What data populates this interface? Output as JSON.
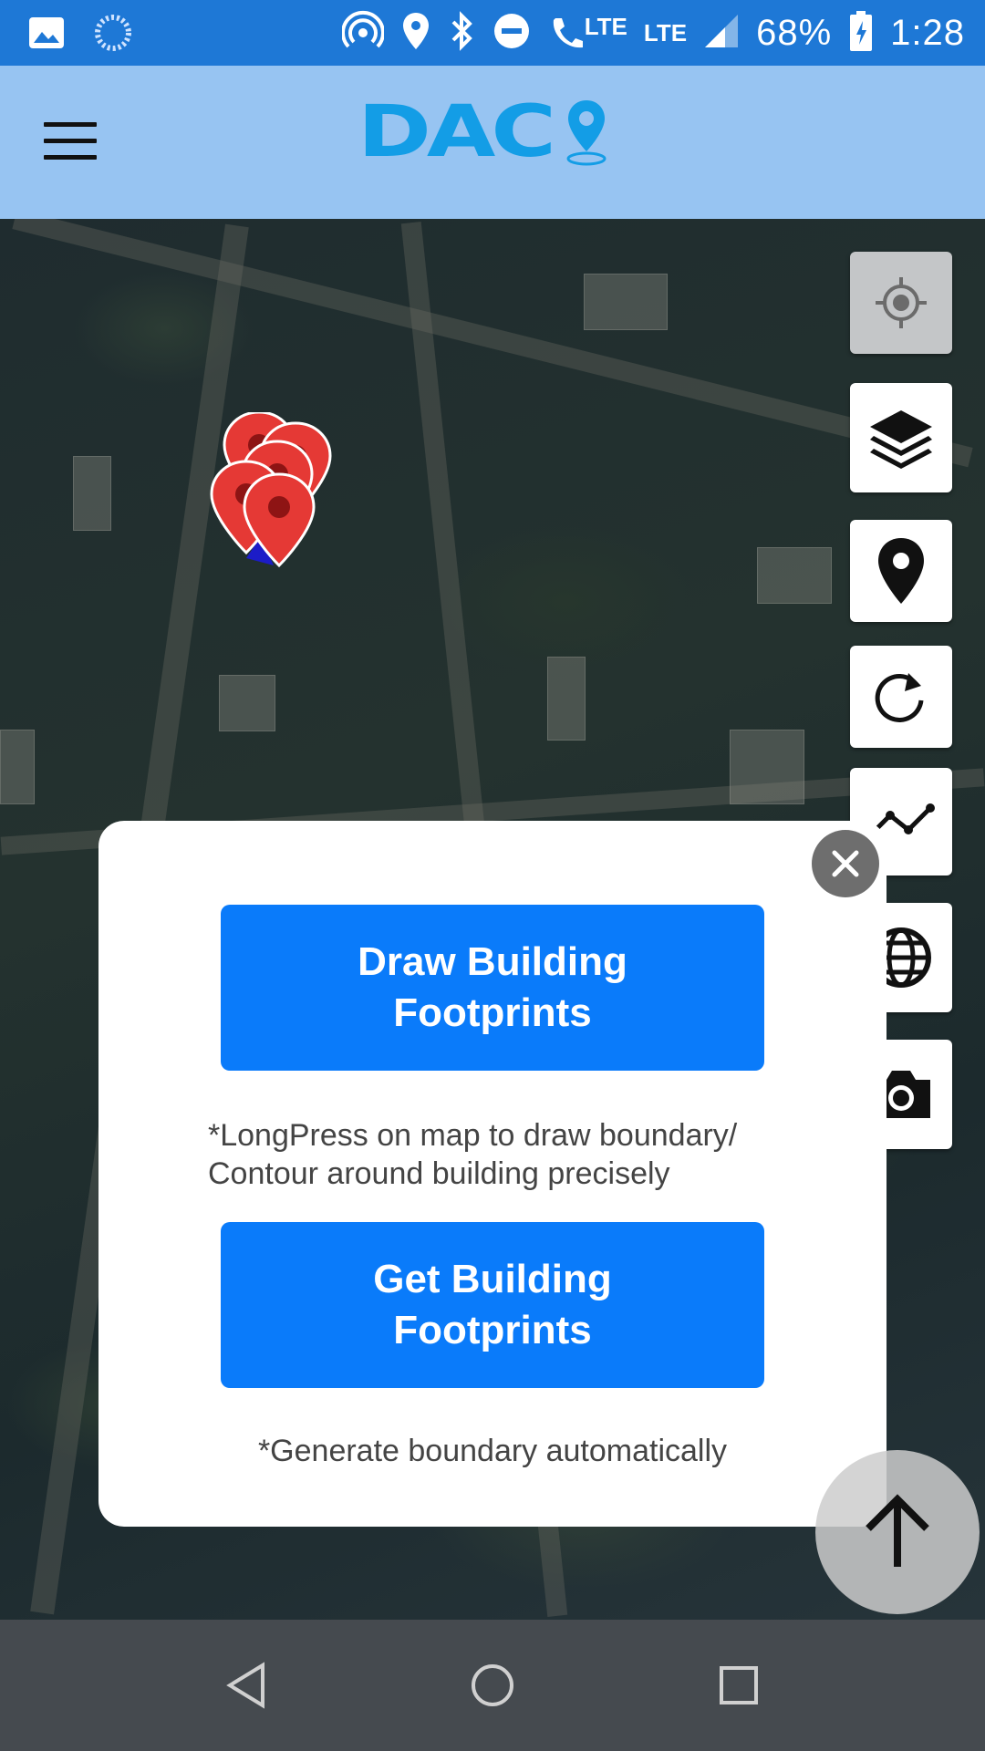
{
  "status_bar": {
    "battery": "68%",
    "time": "1:28",
    "network_1": "LTE",
    "network_2": "LTE",
    "icons": [
      "image-icon",
      "sync-icon",
      "hotspot-icon",
      "location-icon",
      "bluetooth-icon",
      "dnd-icon",
      "lte-call-icon",
      "signal-icon",
      "battery-charging-icon"
    ]
  },
  "app_bar": {
    "logo_text": "DAC",
    "menu_icon": "hamburger-icon"
  },
  "map_controls": [
    {
      "name": "my-location-button",
      "icon": "crosshair-icon"
    },
    {
      "name": "layers-button",
      "icon": "layers-icon"
    },
    {
      "name": "place-marker-button",
      "icon": "pin-icon"
    },
    {
      "name": "refresh-button",
      "icon": "refresh-icon"
    },
    {
      "name": "polyline-button",
      "icon": "polyline-icon"
    },
    {
      "name": "globe-button",
      "icon": "globe-icon"
    },
    {
      "name": "camera-button",
      "icon": "camera-icon"
    }
  ],
  "dialog": {
    "draw_button": "Draw Building Footprints",
    "draw_hint": "*LongPress on map to draw boundary/ Contour around building precisely",
    "get_button": "Get Building Footprints",
    "get_hint": "*Generate boundary automatically",
    "close_icon": "close-icon"
  },
  "colors": {
    "status_bar": "#1e78d6",
    "app_bar": "#97c4f2",
    "logo": "#139de6",
    "primary_button": "#0a7bfa",
    "marker": "#e53935",
    "nav_bar": "#454a4f"
  },
  "nav_bar": {
    "icons": [
      "back-icon",
      "home-icon",
      "recents-icon"
    ]
  }
}
